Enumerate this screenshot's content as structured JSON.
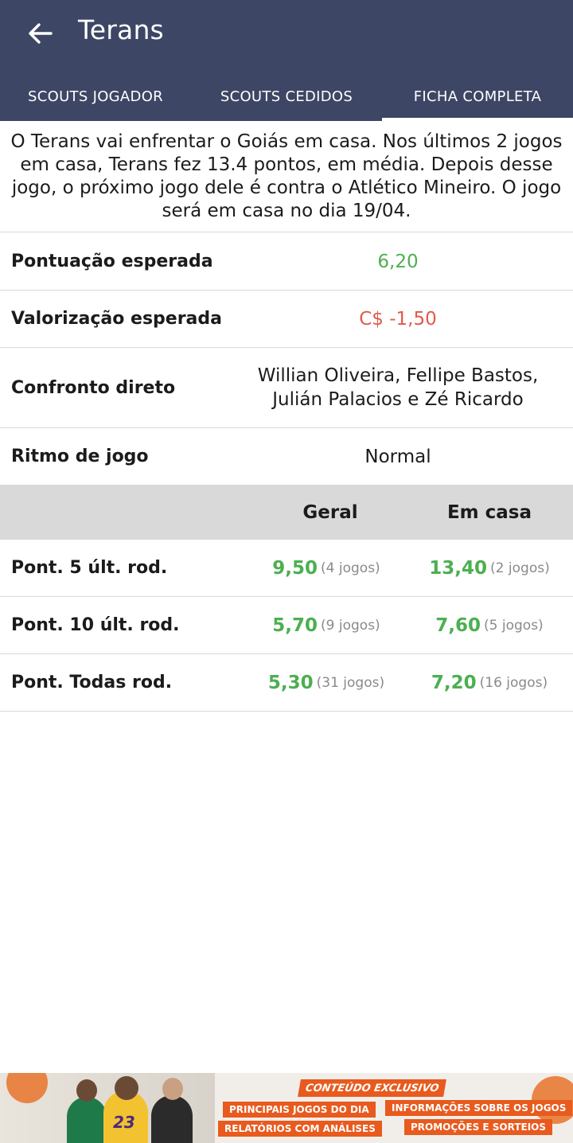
{
  "header": {
    "title": "Terans",
    "tabs": [
      {
        "label": "SCOUTS JOGADOR",
        "active": false
      },
      {
        "label": "SCOUTS CEDIDOS",
        "active": false
      },
      {
        "label": "FICHA COMPLETA",
        "active": true
      }
    ]
  },
  "intro": "O Terans vai enfrentar o Goiás em casa. Nos últimos 2 jogos em casa, Terans fez 13.4 pontos, em média. Depois desse jogo, o próximo jogo dele é contra o Atlético Mineiro. O jogo será em casa no dia 19/04.",
  "info": {
    "pontuacao": {
      "label": "Pontuação esperada",
      "value": "6,20"
    },
    "valorizacao": {
      "label": "Valorização esperada",
      "value": "C$ -1,50"
    },
    "confronto": {
      "label": "Confronto direto",
      "line1": "Willian Oliveira, Fellipe Bastos,",
      "line2": "Julián Palacios e Zé Ricardo"
    },
    "ritmo": {
      "label": "Ritmo de jogo",
      "value": "Normal"
    }
  },
  "stats": {
    "col_geral": "Geral",
    "col_casa": "Em casa",
    "rows": [
      {
        "label": "Pont. 5 últ. rod.",
        "geral": "9,50",
        "geral_games": "(4 jogos)",
        "casa": "13,40",
        "casa_games": "(2 jogos)"
      },
      {
        "label": "Pont. 10 últ. rod.",
        "geral": "5,70",
        "geral_games": "(9 jogos)",
        "casa": "7,60",
        "casa_games": "(5 jogos)"
      },
      {
        "label": "Pont. Todas rod.",
        "geral": "5,30",
        "geral_games": "(31 jogos)",
        "casa": "7,20",
        "casa_games": "(16 jogos)"
      }
    ]
  },
  "banner": {
    "badge": "CONTEÚDO EXCLUSIVO",
    "items": [
      "PRINCIPAIS JOGOS DO DIA",
      "INFORMAÇÕES SOBRE OS JOGOS",
      "RELATÓRIOS COM ANÁLISES",
      "PROMOÇÕES E SORTEIOS"
    ],
    "jersey_text": "23"
  },
  "colors": {
    "appbar": "#3d4664",
    "positive": "#4caf50",
    "negative": "#e05a4b",
    "accent": "#e85a1d"
  }
}
